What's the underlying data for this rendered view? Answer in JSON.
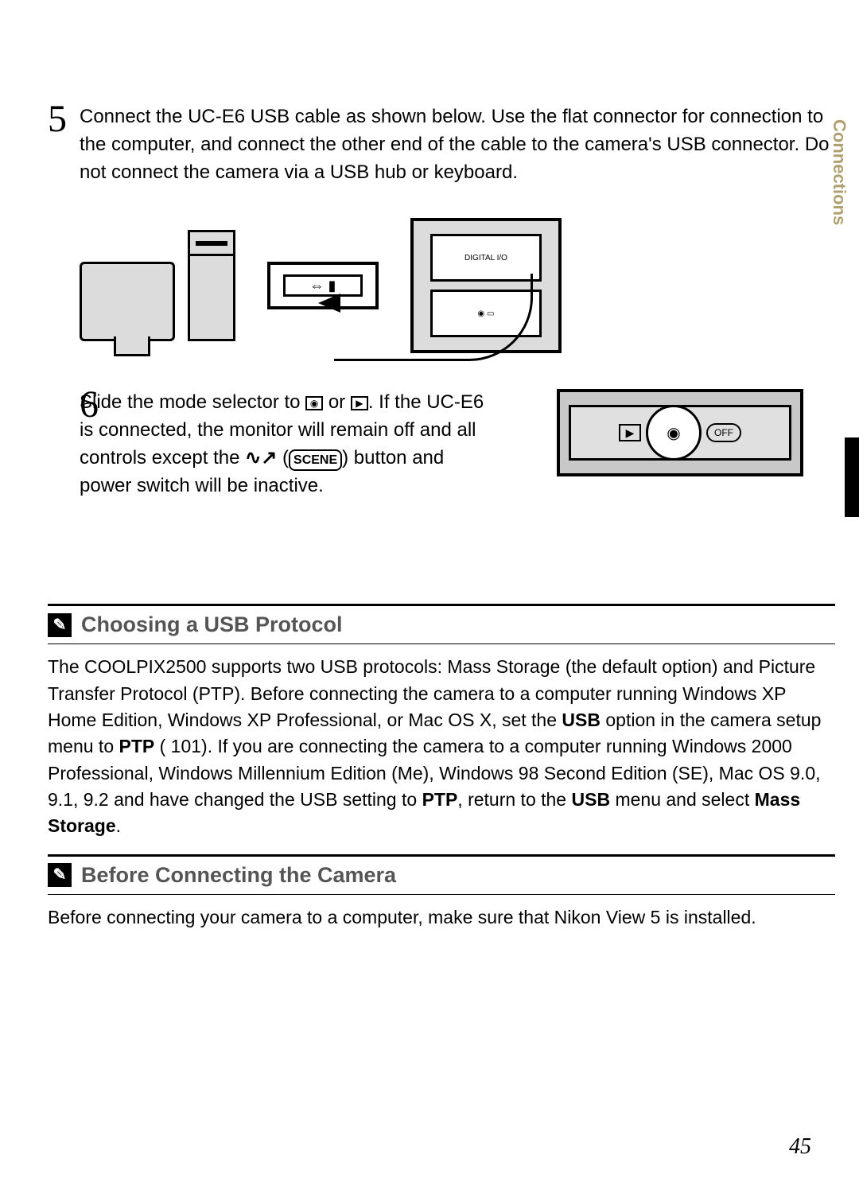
{
  "sideTab": "Connections",
  "pageNumber": "45",
  "step5": {
    "num": "5",
    "text": "Connect the UC-E6 USB cable as shown below. Use the flat connector for connection to the computer, and connect the other end of the cable to the camera's USB connector. Do not connect the camera via a USB hub or keyboard."
  },
  "step6": {
    "num": "6",
    "textPart1": "Slide the mode selector to ",
    "textPart2": " or ",
    "textPart3": ". If the UC-E6 is connected, the monitor will remain off and all controls except the ",
    "textPart4": " (",
    "sceneLabel": "SCENE",
    "textPart5": ") button and power switch will be inactive.",
    "offLabel": "OFF"
  },
  "section1": {
    "title": "Choosing a USB Protocol",
    "body1": "The COOLPIX2500 supports two USB protocols: Mass Storage (the default option) and Picture Transfer Protocol (PTP). Before connecting the camera to a computer running Windows XP Home Edition, Windows XP Professional, or Mac OS X, set the ",
    "usbLabel": "USB",
    "body2": " option in the camera setup menu to ",
    "ptpLabel": "PTP",
    "body3": " ( 101). If you are connecting the camera to a computer running Windows 2000 Professional, Windows Millennium Edition (Me), Windows 98 Second Edition (SE), Mac OS 9.0, 9.1, 9.2 and have changed the USB setting to ",
    "body4": ", return to the ",
    "body5": " menu and select ",
    "massLabel": "Mass Storage",
    "body6": "."
  },
  "section2": {
    "title": "Before Connecting the Camera",
    "body": "Before connecting your camera to a computer, make sure that Nikon View 5 is installed."
  },
  "diagram": {
    "digitalLabel": "DIGITAL I/O"
  }
}
